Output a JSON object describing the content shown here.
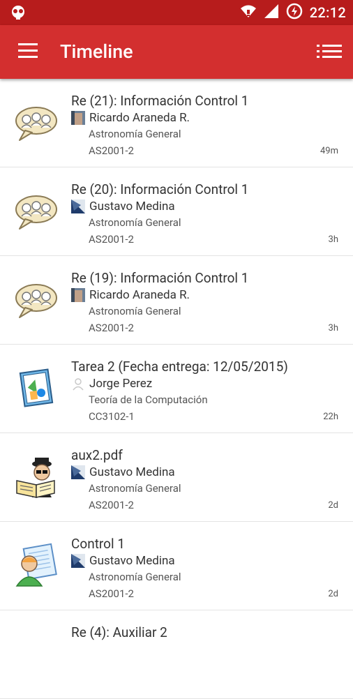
{
  "status_bar": {
    "time": "22:12"
  },
  "app_bar": {
    "title": "Timeline"
  },
  "items": [
    {
      "title": "Re (21): Información Control 1",
      "author": "Ricardo Araneda R.",
      "course": "Astronomía General",
      "code": "AS2001-2",
      "time": "49m",
      "icon": "discussion-icon"
    },
    {
      "title": "Re (20): Información Control 1",
      "author": "Gustavo Medina",
      "course": "Astronomía General",
      "code": "AS2001-2",
      "time": "3h",
      "icon": "discussion-icon"
    },
    {
      "title": "Re (19): Información Control 1",
      "author": "Ricardo Araneda R.",
      "course": "Astronomía General",
      "code": "AS2001-2",
      "time": "3h",
      "icon": "discussion-icon"
    },
    {
      "title": "Tarea 2 (Fecha entrega: 12/05/2015)",
      "author": "Jorge Perez",
      "course": "Teoría de la Computación",
      "code": "CC3102-1",
      "time": "22h",
      "icon": "assignment-icon"
    },
    {
      "title": "aux2.pdf",
      "author": "Gustavo Medina",
      "course": "Astronomía General",
      "code": "AS2001-2",
      "time": "2d",
      "icon": "reader-icon"
    },
    {
      "title": "Control 1",
      "author": "Gustavo Medina",
      "course": "Astronomía General",
      "code": "AS2001-2",
      "time": "2d",
      "icon": "grade-icon"
    },
    {
      "title": "Re (4): Auxiliar 2",
      "author": "",
      "course": "",
      "code": "",
      "time": "",
      "icon": "discussion-icon"
    }
  ]
}
